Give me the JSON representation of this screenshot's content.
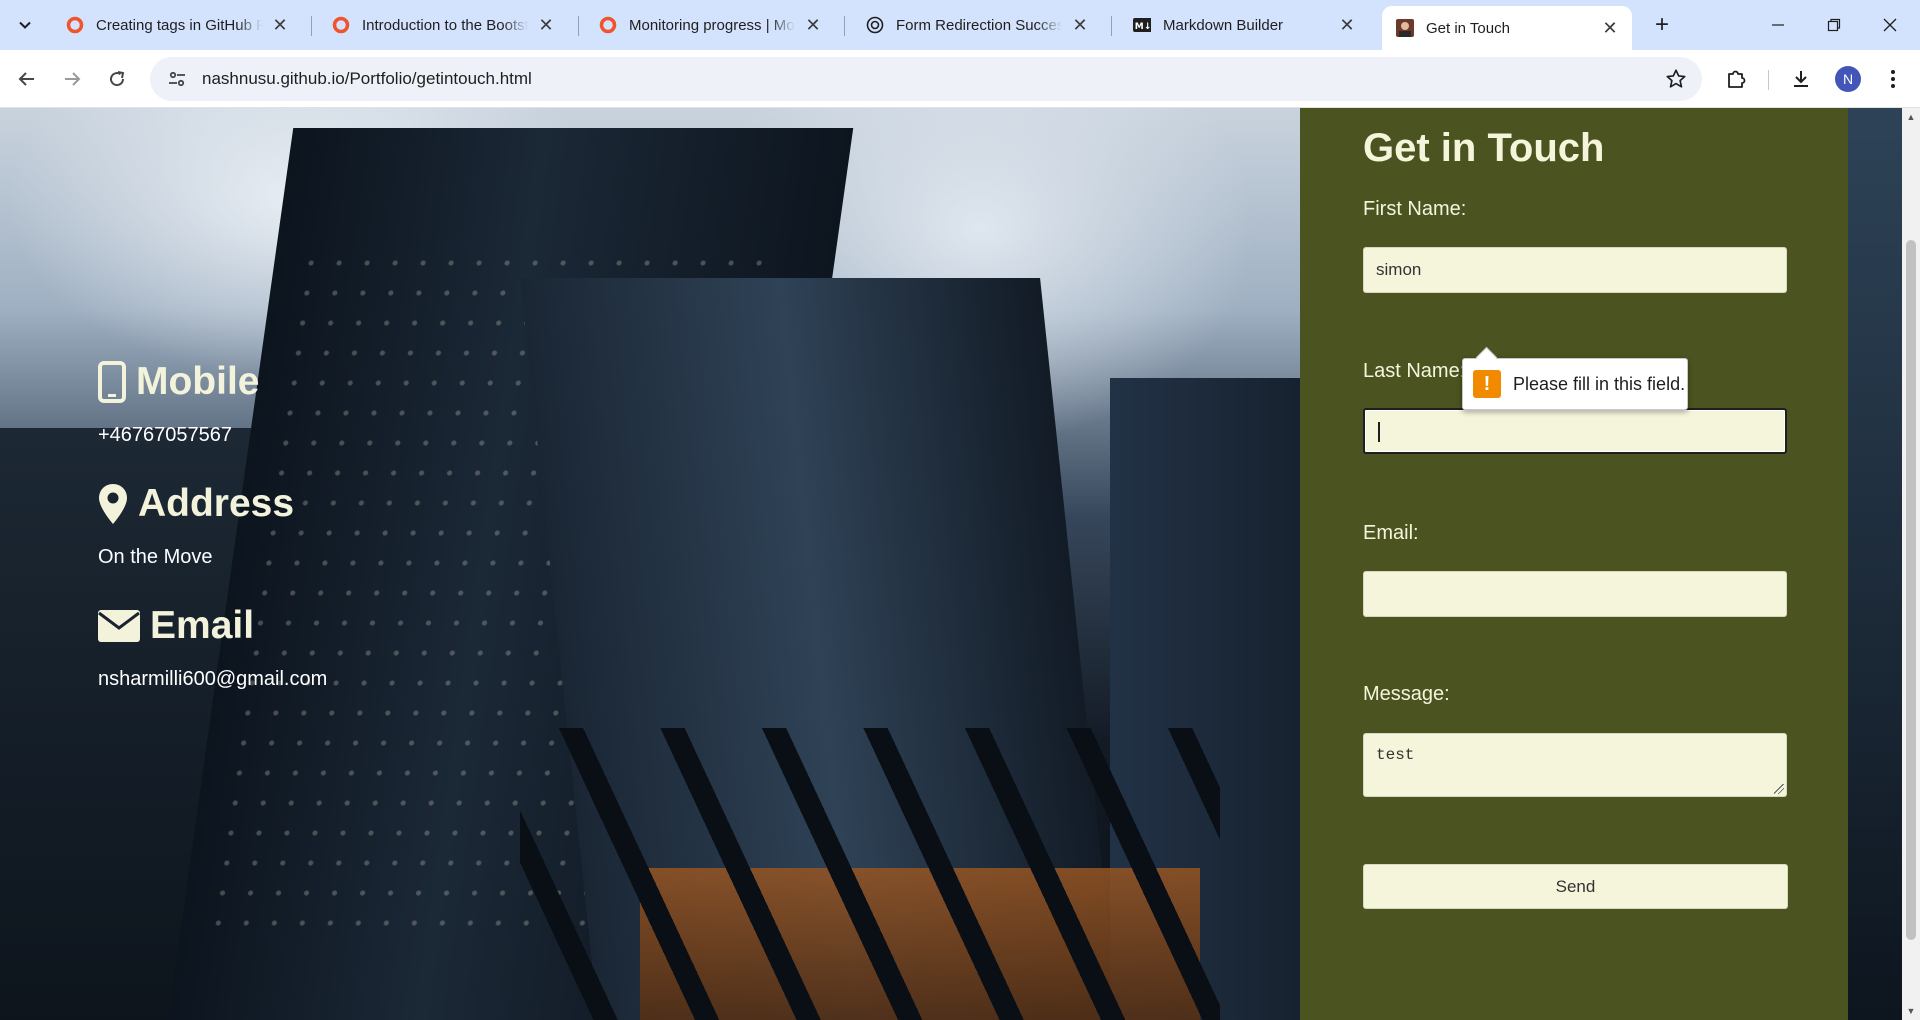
{
  "browser": {
    "tabs": [
      {
        "title": "Creating tags in GitHub Projects",
        "favicon": "circle-orange-icon",
        "active": false
      },
      {
        "title": "Introduction to the Bootstrap",
        "favicon": "circle-orange-icon",
        "active": false
      },
      {
        "title": "Monitoring progress | Monitoring",
        "favicon": "circle-orange-icon",
        "active": false
      },
      {
        "title": "Form Redirection Success",
        "favicon": "openai-icon",
        "active": false
      },
      {
        "title": "Markdown Builder",
        "favicon": "markdown-icon",
        "active": false
      },
      {
        "title": "Get in Touch",
        "favicon": "profile-photo-icon",
        "active": true
      }
    ],
    "url": "nashnusu.github.io/Portfolio/getintouch.html",
    "profile_initial": "N",
    "accent": "#d3e3fd"
  },
  "contact": {
    "mobile_heading": "Mobile",
    "mobile_value": "+46767057567",
    "address_heading": "Address",
    "address_value": "On the Move",
    "email_heading": "Email",
    "email_value": "nsharmilli600@gmail.com"
  },
  "form": {
    "title": "Get in Touch",
    "first_name_label": "First Name:",
    "first_name_value": "simon",
    "last_name_label": "Last Name:",
    "last_name_value": "",
    "email_label": "Email:",
    "email_value": "",
    "message_label": "Message:",
    "message_value": "test",
    "send_label": "Send",
    "panel_color": "#4b5320",
    "field_color": "#f5f5dc"
  },
  "validation": {
    "message": "Please fill in this field.",
    "icon": "warning-icon",
    "icon_color": "#f28a00"
  }
}
